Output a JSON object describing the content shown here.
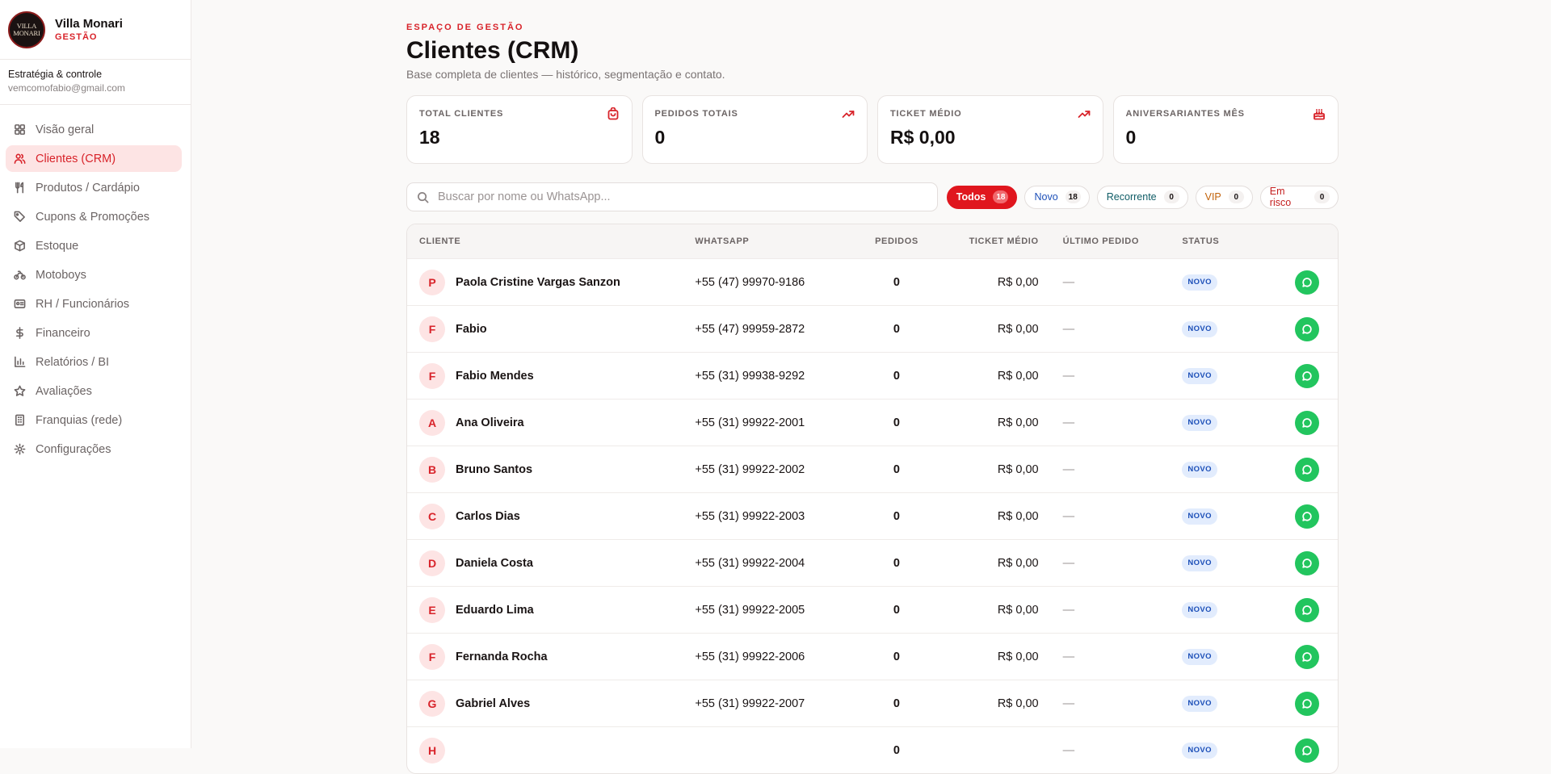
{
  "brand": {
    "logo_line1": "VILLA",
    "logo_line2": "MONARI",
    "name": "Villa Monari",
    "subtitle": "GESTÃO"
  },
  "account": {
    "title": "Estratégia & controle",
    "email": "vemcomofabio@gmail.com"
  },
  "nav": [
    {
      "label": "Visão geral",
      "icon": "grid-icon"
    },
    {
      "label": "Clientes (CRM)",
      "icon": "users-icon",
      "active": true
    },
    {
      "label": "Produtos / Cardápio",
      "icon": "utensils-icon"
    },
    {
      "label": "Cupons & Promoções",
      "icon": "tag-icon"
    },
    {
      "label": "Estoque",
      "icon": "box-icon"
    },
    {
      "label": "Motoboys",
      "icon": "bike-icon"
    },
    {
      "label": "RH / Funcionários",
      "icon": "id-card-icon"
    },
    {
      "label": "Financeiro",
      "icon": "dollar-icon"
    },
    {
      "label": "Relatórios / BI",
      "icon": "bar-chart-icon"
    },
    {
      "label": "Avaliações",
      "icon": "star-icon"
    },
    {
      "label": "Franquias (rede)",
      "icon": "building-icon"
    },
    {
      "label": "Configurações",
      "icon": "gear-icon"
    }
  ],
  "header": {
    "eyebrow": "ESPAÇO DE GESTÃO",
    "title": "Clientes (CRM)",
    "subtitle": "Base completa de clientes — histórico, segmentação e contato."
  },
  "stats": [
    {
      "label": "TOTAL CLIENTES",
      "value": "18",
      "icon": "bag-icon"
    },
    {
      "label": "PEDIDOS TOTAIS",
      "value": "0",
      "icon": "trending-up-icon"
    },
    {
      "label": "TICKET MÉDIO",
      "value": "R$ 0,00",
      "icon": "trending-up-icon"
    },
    {
      "label": "ANIVERSARIANTES MÊS",
      "value": "0",
      "icon": "cake-icon"
    }
  ],
  "search": {
    "placeholder": "Buscar por nome ou WhatsApp..."
  },
  "filters": [
    {
      "label": "Todos",
      "count": "18",
      "color": "#ffffff",
      "active": true
    },
    {
      "label": "Novo",
      "count": "18",
      "color": "#1c4fb8"
    },
    {
      "label": "Recorrente",
      "count": "0",
      "color": "#0f5c66"
    },
    {
      "label": "VIP",
      "count": "0",
      "color": "#c2620a"
    },
    {
      "label": "Em risco",
      "count": "0",
      "color": "#c41e1e"
    }
  ],
  "table": {
    "columns": [
      "CLIENTE",
      "WHATSAPP",
      "PEDIDOS",
      "TICKET MÉDIO",
      "ÚLTIMO PEDIDO",
      "STATUS"
    ],
    "rows": [
      {
        "initial": "P",
        "name": "Paola Cristine Vargas Sanzon",
        "whatsapp": "+55 (47) 99970-9186",
        "orders": "0",
        "ticket": "R$ 0,00",
        "last": "—",
        "status": "NOVO"
      },
      {
        "initial": "F",
        "name": "Fabio",
        "whatsapp": "+55 (47) 99959-2872",
        "orders": "0",
        "ticket": "R$ 0,00",
        "last": "—",
        "status": "NOVO"
      },
      {
        "initial": "F",
        "name": "Fabio Mendes",
        "whatsapp": "+55 (31) 99938-9292",
        "orders": "0",
        "ticket": "R$ 0,00",
        "last": "—",
        "status": "NOVO"
      },
      {
        "initial": "A",
        "name": "Ana Oliveira",
        "whatsapp": "+55 (31) 99922-2001",
        "orders": "0",
        "ticket": "R$ 0,00",
        "last": "—",
        "status": "NOVO"
      },
      {
        "initial": "B",
        "name": "Bruno Santos",
        "whatsapp": "+55 (31) 99922-2002",
        "orders": "0",
        "ticket": "R$ 0,00",
        "last": "—",
        "status": "NOVO"
      },
      {
        "initial": "C",
        "name": "Carlos Dias",
        "whatsapp": "+55 (31) 99922-2003",
        "orders": "0",
        "ticket": "R$ 0,00",
        "last": "—",
        "status": "NOVO"
      },
      {
        "initial": "D",
        "name": "Daniela Costa",
        "whatsapp": "+55 (31) 99922-2004",
        "orders": "0",
        "ticket": "R$ 0,00",
        "last": "—",
        "status": "NOVO"
      },
      {
        "initial": "E",
        "name": "Eduardo Lima",
        "whatsapp": "+55 (31) 99922-2005",
        "orders": "0",
        "ticket": "R$ 0,00",
        "last": "—",
        "status": "NOVO"
      },
      {
        "initial": "F",
        "name": "Fernanda Rocha",
        "whatsapp": "+55 (31) 99922-2006",
        "orders": "0",
        "ticket": "R$ 0,00",
        "last": "—",
        "status": "NOVO"
      },
      {
        "initial": "G",
        "name": "Gabriel Alves",
        "whatsapp": "+55 (31) 99922-2007",
        "orders": "0",
        "ticket": "R$ 0,00",
        "last": "—",
        "status": "NOVO"
      },
      {
        "initial": "H",
        "name": "",
        "whatsapp": "",
        "orders": "0",
        "ticket": "",
        "last": "—",
        "status": "NOVO"
      }
    ]
  },
  "colors": {
    "accent": "#d8232a",
    "accent_soft": "#fde4e4",
    "whatsapp": "#22c55e",
    "badge_bg": "#e2ecfd",
    "badge_text": "#1c4fb8"
  }
}
